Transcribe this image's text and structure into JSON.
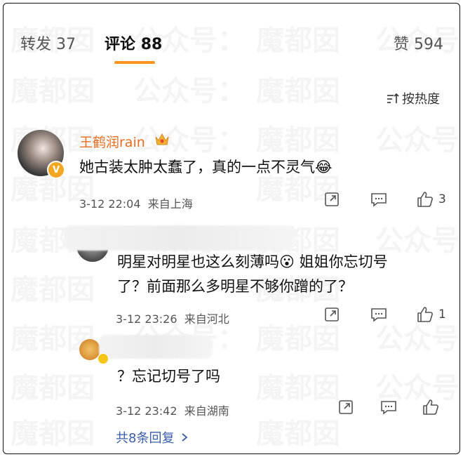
{
  "tabs": {
    "repost_label": "转发",
    "repost_count": "37",
    "comment_label": "评论",
    "comment_count": "88",
    "like_label": "赞",
    "like_count": "594"
  },
  "sort": {
    "label": "按热度"
  },
  "comments": [
    {
      "username": "王鹤润rain",
      "text": "她古装太肿太蠢了，真的一点不灵气😂",
      "date": "3-12 22:04",
      "location": "来自上海",
      "likes": "3"
    },
    {
      "text_line1": "明星对明星也这么刻薄吗😮 姐姐你忘切号",
      "text_line2": "了？前面那么多明星不够你蹭的了？",
      "date": "3-12 23:26",
      "location": "来自河北",
      "likes": "1"
    },
    {
      "text": "？忘记切号了吗",
      "date": "3-12 23:42",
      "location": "来自湖南"
    }
  ],
  "replies_link": "共8条回复",
  "watermark": [
    "魔都囡",
    "公众号："
  ],
  "colors": {
    "accent": "#f7931e",
    "username": "#e86b1e",
    "link": "#3a5ea9"
  }
}
